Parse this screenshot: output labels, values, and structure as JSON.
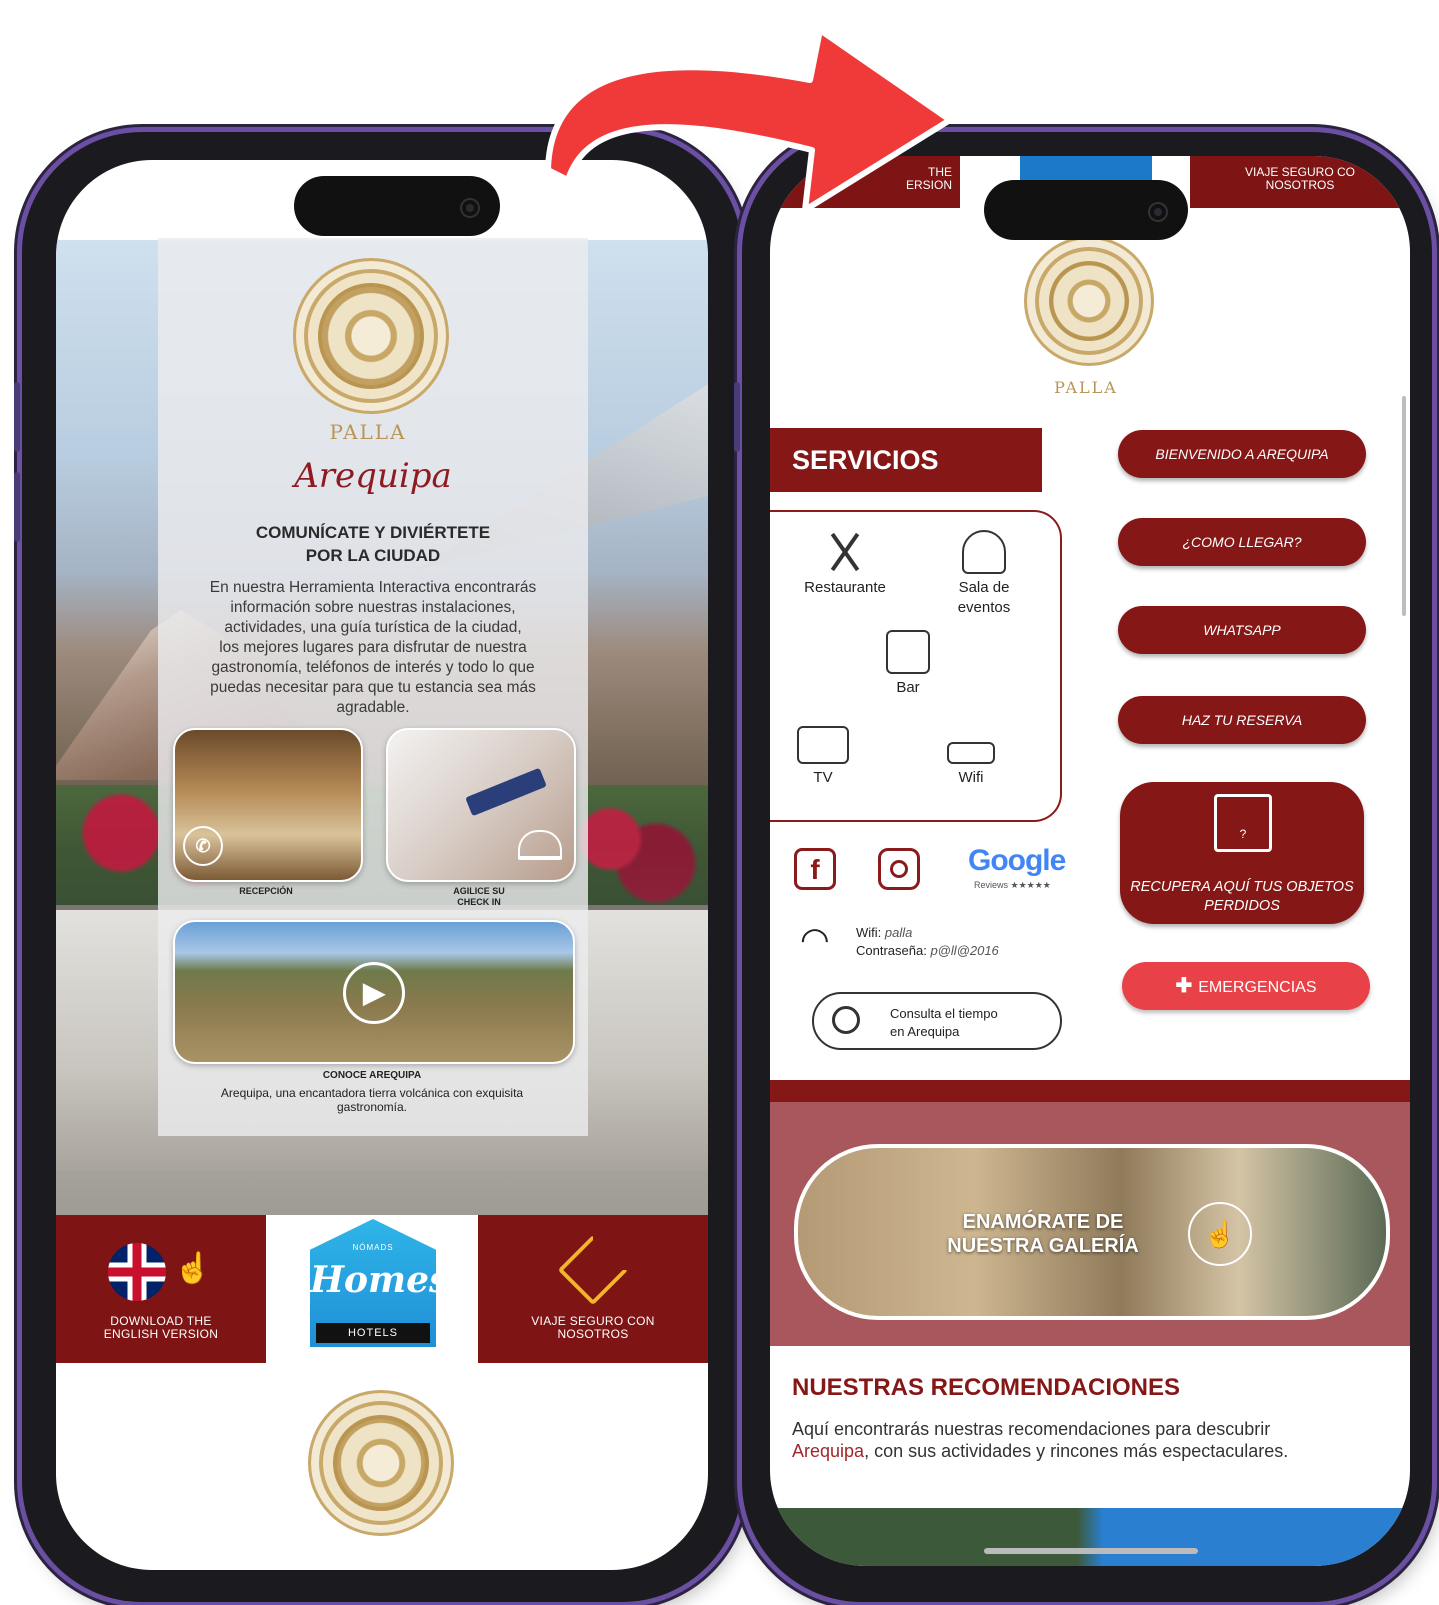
{
  "left": {
    "logo_word": "PALLA",
    "script_title": "Arequipa",
    "heading_line1": "COMUNÍCATE Y DIVIÉRTETE",
    "heading_line2": "POR LA CIUDAD",
    "body_lines": [
      "En nuestra Herramienta Interactiva encontrarás",
      "información sobre nuestras instalaciones,",
      "actividades, una guía turística de la ciudad,",
      "los mejores lugares para disfrutar de nuestra",
      "gastronomía, teléfonos de interés y todo lo que",
      "puedas necesitar para que tu estancia sea más",
      "agradable."
    ],
    "tiles": {
      "reception": "RECEPCIÓN",
      "checkin_line1": "AGILICE SU",
      "checkin_line2": "CHECK IN",
      "video_title": "CONOCE AREQUIPA",
      "video_desc_line1": "Arequipa, una encantadora tierra volcánica con exquisita",
      "video_desc_line2": "gastronomía."
    },
    "bottom_bar": {
      "english_line1": "DOWNLOAD THE",
      "english_line2": "ENGLISH VERSION",
      "homes_small": "NÓMADS",
      "homes_word": "Homes",
      "homes_hotels": "HOTELS",
      "viaje_line1": "VIAJE SEGURO CON",
      "viaje_line2": "NOSOTROS"
    }
  },
  "right": {
    "top_banner_left_line1": "THE",
    "top_banner_left_line2": "ERSION",
    "top_banner_right_line1": "VIAJE SEGURO CO",
    "top_banner_right_line2": "NOSOTROS",
    "logo_word": "PALLA",
    "servicios_title": "SERVICIOS",
    "services": {
      "restaurante": "Restaurante",
      "sala_line1": "Sala de",
      "sala_line2": "eventos",
      "bar": "Bar",
      "tv": "TV",
      "wifi": "Wifi"
    },
    "buttons": {
      "bienvenido": "BIENVENIDO A AREQUIPA",
      "como_llegar": "¿COMO LLEGAR?",
      "whatsapp": "WHATSAPP",
      "reserva": "HAZ TU RESERVA",
      "lost_line1": "RECUPERA AQUÍ TUS OBJETOS",
      "lost_line2": "PERDIDOS",
      "emergencias": "EMERGENCIAS"
    },
    "google_word": "Google",
    "google_reviews": "Reviews ★★★★★",
    "wifi_label": "Wifi:",
    "wifi_value": "palla",
    "password_label": "Contraseña:",
    "password_value": "p@ll@2016",
    "weather_line1": "Consulta el tiempo",
    "weather_line2": "en Arequipa",
    "gallery_line1": "ENAMÓRATE DE",
    "gallery_line2": "NUESTRA GALERÍA",
    "reco_title": "NUESTRAS RECOMENDACIONES",
    "reco_line1": "Aquí encontrarás nuestras recomendaciones para descubrir",
    "reco_highlight": "Arequipa",
    "reco_line2_rest": ", con sus actividades y rincones más espectaculares."
  },
  "colors": {
    "brand_red": "#861717",
    "emergency_red": "#e84148",
    "gold": "#c9a96a",
    "arrow_red": "#f03a3a"
  }
}
